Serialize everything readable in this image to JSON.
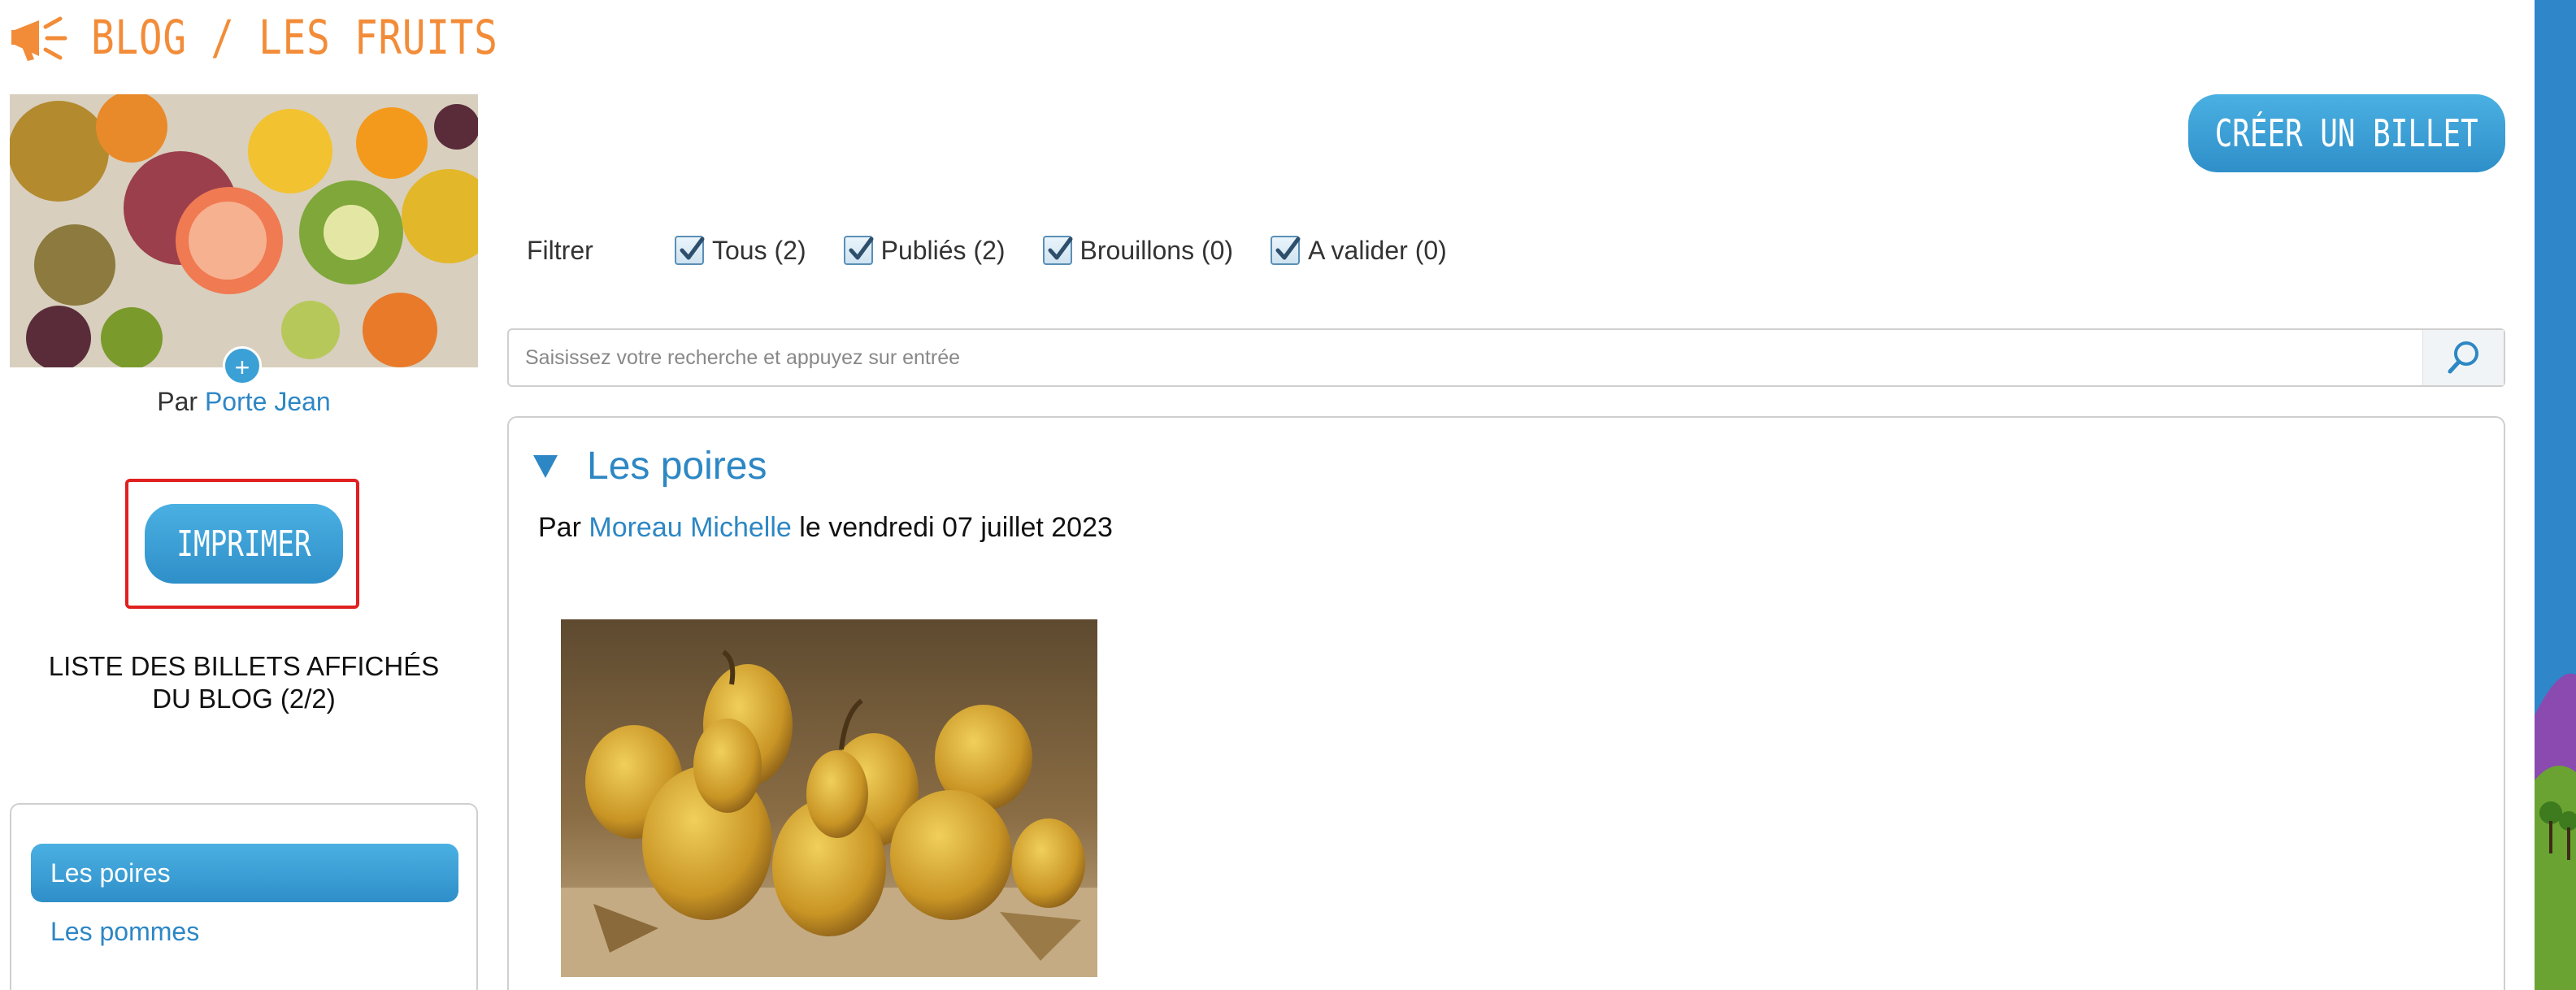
{
  "header": {
    "title": "BLOG / LES FRUITS",
    "icon": "megaphone-icon",
    "title_color": "#f28c38"
  },
  "sidebar": {
    "cover_add_icon": "+",
    "author_prefix": "Par",
    "author_name": "Porte Jean",
    "print_label": "IMPRIMER",
    "list_title_line1": "LISTE DES BILLETS AFFICHÉS",
    "list_title_line2": "DU BLOG (2/2)",
    "posts": [
      {
        "label": "Les poires",
        "active": true
      },
      {
        "label": "Les pommes",
        "active": false
      }
    ]
  },
  "toolbar": {
    "create_label": "CRÉER UN BILLET"
  },
  "filters": {
    "label": "Filtrer",
    "items": [
      {
        "label": "Tous (2)",
        "checked": true
      },
      {
        "label": "Publiés (2)",
        "checked": true
      },
      {
        "label": "Brouillons (0)",
        "checked": true
      },
      {
        "label": "A valider (0)",
        "checked": true
      }
    ]
  },
  "search": {
    "value": "",
    "placeholder": "Saisissez votre recherche et appuyez sur entrée",
    "icon": "search-icon"
  },
  "post": {
    "title": "Les poires",
    "meta_prefix": "Par",
    "author": "Moreau Michelle",
    "date_text": "le vendredi 07 juillet 2023"
  },
  "colors": {
    "accent": "#3aa0d6",
    "link": "#2d87c4",
    "highlight_frame": "#e02020"
  }
}
